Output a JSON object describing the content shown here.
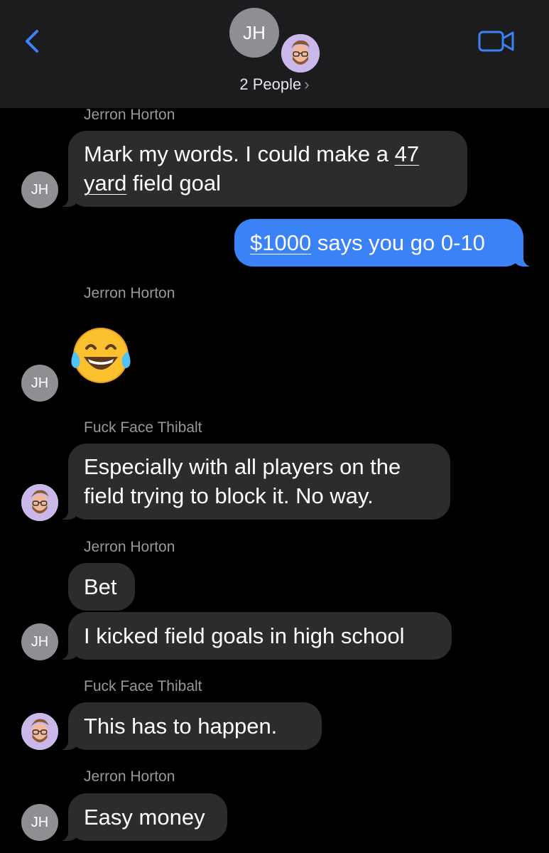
{
  "header": {
    "group_initials": "JH",
    "people_label": "2 People",
    "chevron": "›",
    "back_icon": "chevron-left-icon",
    "video_icon": "video-camera-icon",
    "accent_color": "#3a82f6"
  },
  "messages": [
    {
      "sender": "Jerron Horton",
      "text_parts": [
        "Mark my words. I could make a ",
        "47",
        "yard",
        " field goal"
      ],
      "side": "left"
    },
    {
      "sender": "me",
      "text_parts": [
        "$1000",
        " says you go 0-10"
      ],
      "side": "right"
    },
    {
      "sender": "Jerron Horton",
      "emoji": "face-with-tears-of-joy",
      "side": "left"
    },
    {
      "sender": "Fuck Face Thibalt",
      "text_line1": "Especially with all players on the",
      "text_line2": "field trying to block it.  No way.",
      "side": "left"
    },
    {
      "sender": "Jerron Horton",
      "text": "Bet",
      "side": "left"
    },
    {
      "sender": "Jerron Horton",
      "text": "I kicked field goals in high school",
      "side": "left"
    },
    {
      "sender": "Fuck Face Thibalt",
      "text": "This has to happen.",
      "side": "left"
    },
    {
      "sender": "Jerron Horton",
      "text": "Easy money",
      "side": "left"
    }
  ],
  "avatars": {
    "jh_initials": "JH",
    "memoji_icon": "memoji-avatar-icon"
  }
}
